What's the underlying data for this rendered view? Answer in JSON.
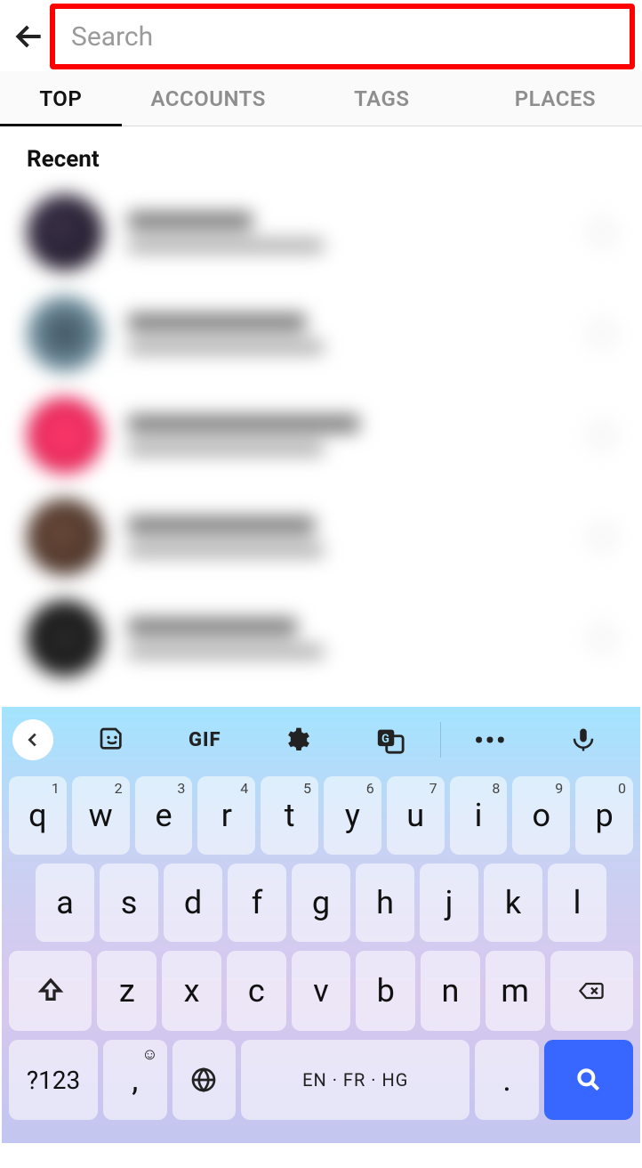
{
  "header": {
    "search_placeholder": "Search"
  },
  "tabs": [
    {
      "id": "top",
      "label": "TOP",
      "active": true
    },
    {
      "id": "accounts",
      "label": "ACCOUNTS",
      "active": false
    },
    {
      "id": "tags",
      "label": "TAGS",
      "active": false
    },
    {
      "id": "places",
      "label": "PLACES",
      "active": false
    }
  ],
  "recent_heading": "Recent",
  "keyboard": {
    "gif_label": "GIF",
    "row1": [
      {
        "k": "q",
        "n": "1"
      },
      {
        "k": "w",
        "n": "2"
      },
      {
        "k": "e",
        "n": "3"
      },
      {
        "k": "r",
        "n": "4"
      },
      {
        "k": "t",
        "n": "5"
      },
      {
        "k": "y",
        "n": "6"
      },
      {
        "k": "u",
        "n": "7"
      },
      {
        "k": "i",
        "n": "8"
      },
      {
        "k": "o",
        "n": "9"
      },
      {
        "k": "p",
        "n": "0"
      }
    ],
    "row2": [
      "a",
      "s",
      "d",
      "f",
      "g",
      "h",
      "j",
      "k",
      "l"
    ],
    "row3": [
      "z",
      "x",
      "c",
      "v",
      "b",
      "n",
      "m"
    ],
    "sym_label": "?123",
    "space_label": "EN · FR · HG",
    "comma": ",",
    "period": ".",
    "emoji_hint": "☺"
  }
}
